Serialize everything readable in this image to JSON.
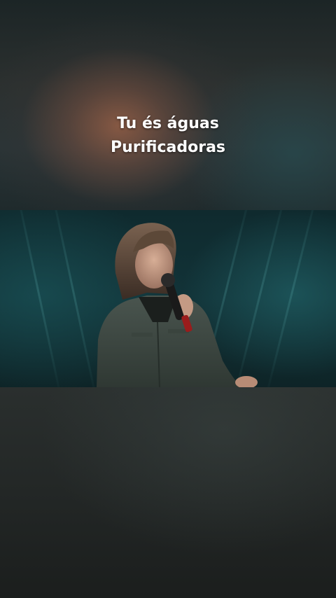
{
  "caption": {
    "line1": "Tu és águas",
    "line2": "Purificadoras"
  },
  "video": {
    "scene": "singer-with-microphone"
  },
  "colors": {
    "caption_text": "#ffffff",
    "video_bg": "#123338",
    "jacket": "#3f4a44",
    "mic_accent": "#9a1c1c"
  }
}
